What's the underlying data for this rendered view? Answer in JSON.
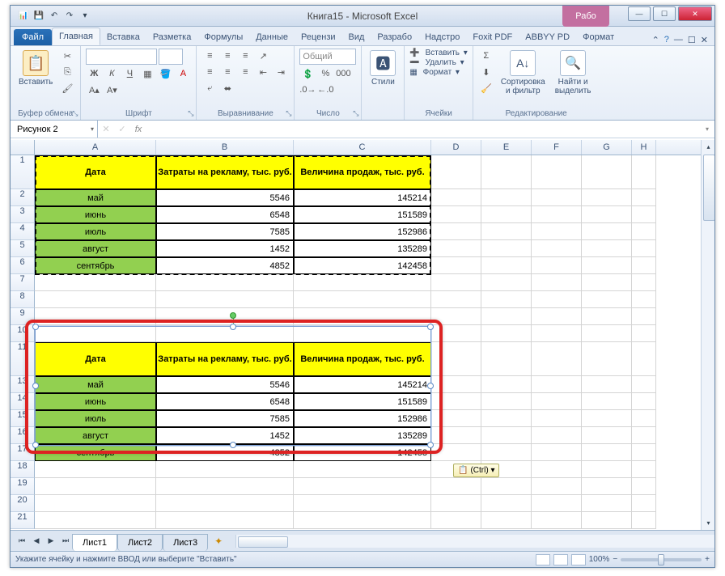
{
  "title": "Книга15  -  Microsoft Excel",
  "contextual_tab": "Рабо",
  "qat": {
    "save": "💾",
    "undo": "↶",
    "redo": "↷"
  },
  "tabs": {
    "file": "Файл",
    "items": [
      "Главная",
      "Вставка",
      "Разметка",
      "Формулы",
      "Данные",
      "Рецензи",
      "Вид",
      "Разрабо",
      "Надстро",
      "Foxit PDF",
      "ABBYY PD",
      "Формат"
    ]
  },
  "ribbon": {
    "clipboard": {
      "paste": "Вставить",
      "label": "Буфер обмена"
    },
    "font": {
      "label": "Шрифт"
    },
    "alignment": {
      "label": "Выравнивание"
    },
    "number": {
      "general": "Общий",
      "label": "Число"
    },
    "styles": {
      "btn": "Стили",
      "label": ""
    },
    "cells": {
      "insert": "Вставить",
      "delete": "Удалить",
      "format": "Формат",
      "label": "Ячейки"
    },
    "editing": {
      "sort": "Сортировка\nи фильтр",
      "find": "Найти и\nвыделить",
      "label": "Редактирование"
    }
  },
  "namebox": "Рисунок 2",
  "fx_label": "fx",
  "columns": [
    "A",
    "B",
    "C",
    "D",
    "E",
    "F",
    "G",
    "H"
  ],
  "table": {
    "headers": [
      "Дата",
      "Затраты на рекламу, тыс. руб.",
      "Величина продаж, тыс. руб."
    ],
    "rows": [
      {
        "m": "май",
        "a": "5546",
        "b": "145214"
      },
      {
        "m": "июнь",
        "a": "6548",
        "b": "151589"
      },
      {
        "m": "июль",
        "a": "7585",
        "b": "152986"
      },
      {
        "m": "август",
        "a": "1452",
        "b": "135289"
      },
      {
        "m": "сентябрь",
        "a": "4852",
        "b": "142458"
      }
    ]
  },
  "smart_tag": "(Ctrl) ▾",
  "smart_tag_icon": "📋",
  "sheet_tabs": [
    "Лист1",
    "Лист2",
    "Лист3"
  ],
  "status_text": "Укажите ячейку и нажмите ВВОД или выберите \"Вставить\"",
  "zoom": "100%"
}
